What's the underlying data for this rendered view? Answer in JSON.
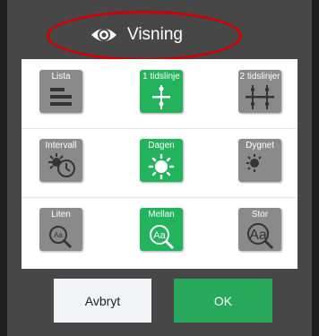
{
  "dialog": {
    "title": "Visning",
    "title_icon": "eye-icon",
    "highlight_color": "#d10000"
  },
  "options": {
    "layout": [
      {
        "label": "Lista",
        "icon": "list-icon",
        "selected": false
      },
      {
        "label": "1 tidslinje",
        "icon": "one-timeline-icon",
        "selected": true
      },
      {
        "label": "2 tidslinjer",
        "icon": "two-timelines-icon",
        "selected": false
      }
    ],
    "period": [
      {
        "label": "Intervall",
        "icon": "sun-clock-icon",
        "selected": false
      },
      {
        "label": "Dagen",
        "icon": "sun-icon",
        "selected": true
      },
      {
        "label": "Dygnet",
        "icon": "sun-moon-icon",
        "selected": false
      }
    ],
    "text_size": [
      {
        "label": "Liten",
        "icon": "magnifier-small-text-icon",
        "glyph": "Aa",
        "selected": false
      },
      {
        "label": "Mellan",
        "icon": "magnifier-medium-text-icon",
        "glyph": "Aa",
        "selected": true
      },
      {
        "label": "Stor",
        "icon": "magnifier-large-text-icon",
        "glyph": "Aa",
        "selected": false
      }
    ]
  },
  "buttons": {
    "cancel": "Avbryt",
    "ok": "OK"
  },
  "colors": {
    "selected": "#23b35c",
    "unselected": "#8a8a8a",
    "ok_button": "#27a85a",
    "cancel_button": "#f1f3f6",
    "dialog_bg": "#474747"
  }
}
